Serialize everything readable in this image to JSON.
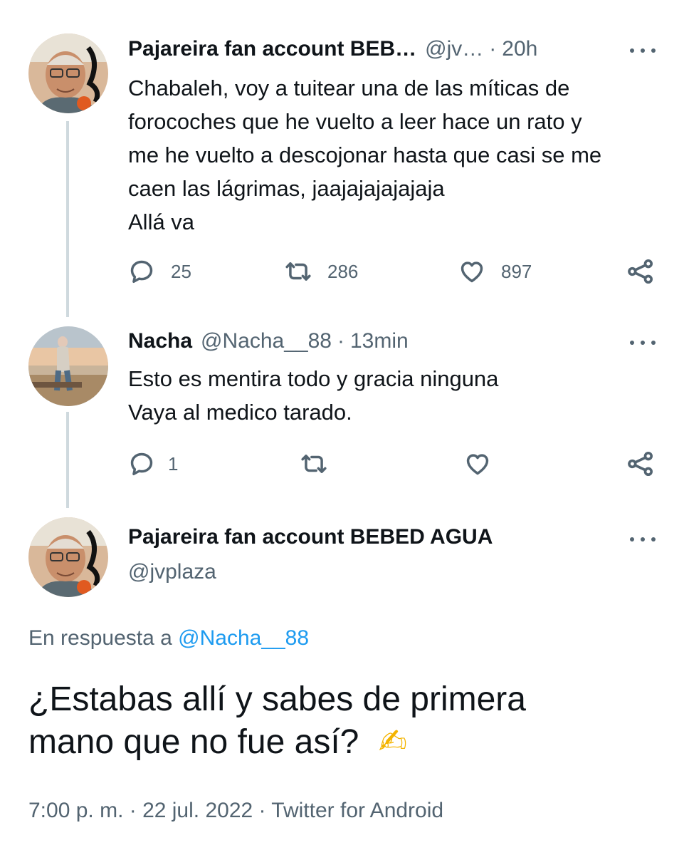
{
  "tweet1": {
    "name": "Pajareira fan account BEB…",
    "handle": "@jv…",
    "time": "20h",
    "lines": [
      "Chabaleh, voy a tuitear una de las míticas de",
      "forocoches que he vuelto a leer hace un rato y",
      "me he vuelto a descojonar hasta que casi se me",
      "caen las lágrimas, jaajajajajajaja",
      "Allá va"
    ],
    "replies": "25",
    "retweets": "286",
    "likes": "897"
  },
  "tweet2": {
    "name": "Nacha",
    "handle": "@Nacha__88",
    "time": "13min",
    "lines": [
      "Esto es mentira todo y gracia ninguna",
      "Vaya al medico tarado."
    ],
    "replies": "1"
  },
  "main": {
    "name": "Pajareira fan account BEBED AGUA",
    "handle": "@jvplaza",
    "reply_prefix": "En respuesta a",
    "reply_mention": "@Nacha__88",
    "text_line1": "¿Estabas allí y sabes de primera",
    "text_line2": "mano que no fue así?",
    "emoji": "✍",
    "footer": "7:00 p. m. · 22 jul. 2022 · Twitter for Android"
  },
  "separator": "·",
  "icons": {
    "reply": "reply-bubble-icon",
    "retweet": "retweet-icon",
    "like": "heart-icon",
    "share": "share-icon",
    "more": "more-dots-icon"
  },
  "colors": {
    "text": "#0f1419",
    "secondary": "#536471",
    "accent": "#1d9bf0",
    "thread": "#cfd9de"
  }
}
